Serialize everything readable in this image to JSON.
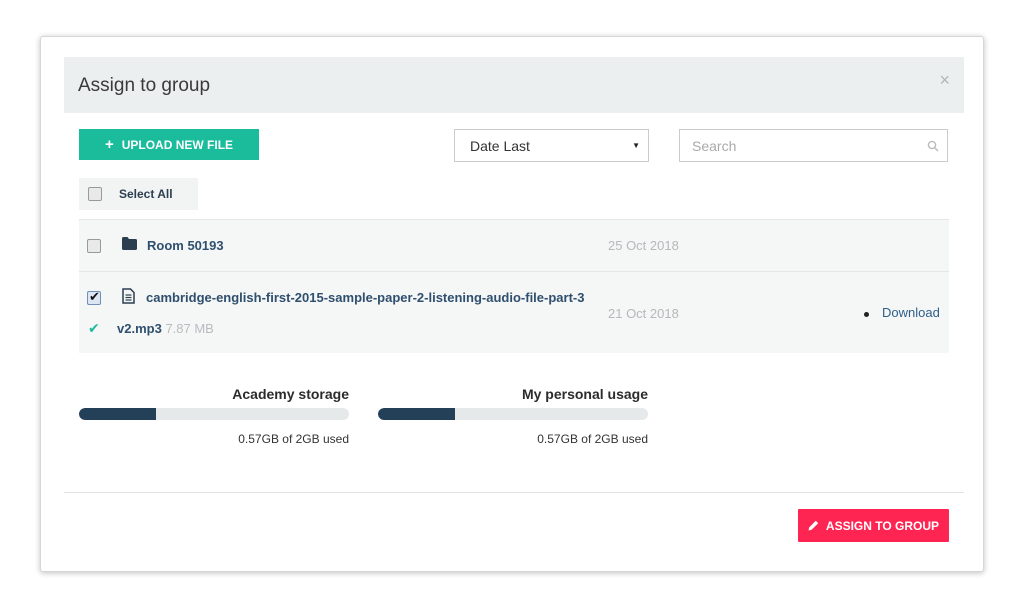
{
  "modal": {
    "title": "Assign to group",
    "close_symbol": "×"
  },
  "toolbar": {
    "upload_label": "Upload New File",
    "upload_icon": "plus-icon",
    "sort_selected": "Date Last",
    "search_placeholder": "Search",
    "search_value": ""
  },
  "select_all": {
    "label": "Select All",
    "checked": false
  },
  "files": [
    {
      "type": "folder",
      "icon": "folder-icon",
      "name": "Room 50193",
      "date": "25 Oct 2018",
      "checked": false
    },
    {
      "type": "file",
      "icon": "document-icon",
      "name_line1": "cambridge-english-first-2015-sample-paper-2-listening-audio-file-part-3",
      "name_line2": "v2.mp3",
      "size": "7.87 MB",
      "date": "21 Oct 2018",
      "checked": true,
      "action": "Download"
    }
  ],
  "storage": {
    "academy": {
      "label": "Academy storage",
      "used_text": "0.57GB of 2GB used",
      "fraction": 0.285
    },
    "personal": {
      "label": "My personal usage",
      "used_text": "0.57GB of 2GB used",
      "fraction": 0.285
    }
  },
  "footer": {
    "assign_label": "Assign to group"
  },
  "colors": {
    "upload_button": "#1abc9c",
    "assign_button": "#ff2553",
    "bar_fill": "#243f58",
    "header_bg": "#eceff0"
  }
}
